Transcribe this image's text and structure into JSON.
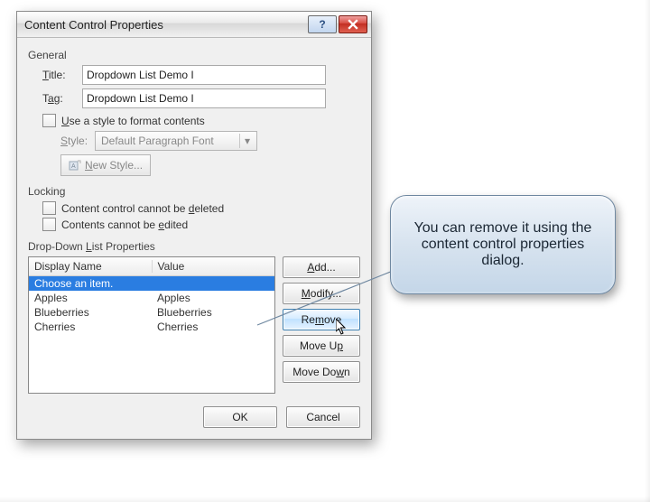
{
  "dialog": {
    "title": "Content Control Properties",
    "sections": {
      "general_label": "General",
      "title_label": "Title:",
      "title_value": "Dropdown List Demo I",
      "tag_label": "Tag:",
      "tag_value": "Dropdown List Demo I",
      "use_style_label": "Use a style to format contents",
      "style_label": "Style:",
      "style_value": "Default Paragraph Font",
      "new_style_label": "New Style...",
      "locking_label": "Locking",
      "lock_delete_label": "Content control cannot be deleted",
      "lock_edit_label": "Contents cannot be edited",
      "ddl_label": "Drop-Down List Properties",
      "col_display": "Display Name",
      "col_value": "Value",
      "items": [
        {
          "display": "Choose an item.",
          "value": "",
          "selected": true
        },
        {
          "display": "Apples",
          "value": "Apples",
          "selected": false
        },
        {
          "display": "Blueberries",
          "value": "Blueberries",
          "selected": false
        },
        {
          "display": "Cherries",
          "value": "Cherries",
          "selected": false
        }
      ],
      "btn_add": "Add...",
      "btn_modify": "Modify...",
      "btn_remove": "Remove",
      "btn_moveup": "Move Up",
      "btn_movedown": "Move Down",
      "btn_ok": "OK",
      "btn_cancel": "Cancel"
    }
  },
  "callout": {
    "text": "You can remove it using the content control properties dialog."
  }
}
